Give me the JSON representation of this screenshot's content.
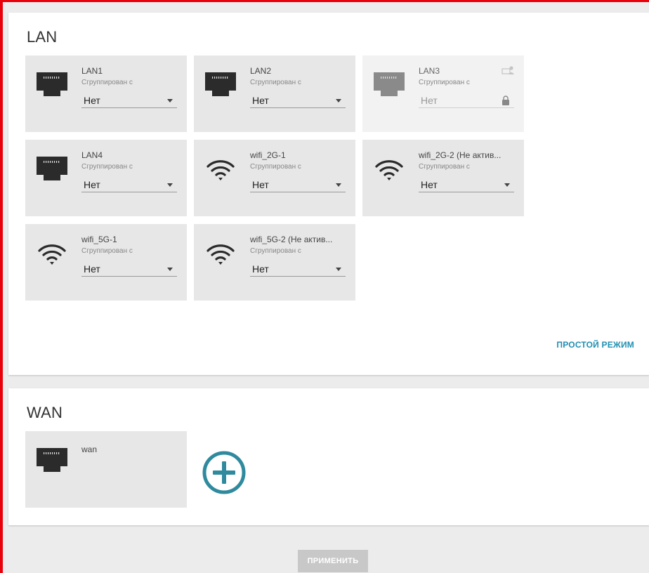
{
  "lan": {
    "title": "LAN",
    "ports": [
      {
        "name": "LAN1",
        "sub": "Сгруппирован с",
        "value": "Нет",
        "type": "ethernet",
        "state": "active"
      },
      {
        "name": "LAN2",
        "sub": "Сгруппирован с",
        "value": "Нет",
        "type": "ethernet",
        "state": "active"
      },
      {
        "name": "LAN3",
        "sub": "Сгруппирован с",
        "value": "Нет",
        "type": "ethernet",
        "state": "locked"
      },
      {
        "name": "LAN4",
        "sub": "Сгруппирован с",
        "value": "Нет",
        "type": "ethernet",
        "state": "active"
      },
      {
        "name": "wifi_2G-1",
        "sub": "Сгруппирован с",
        "value": "Нет",
        "type": "wifi",
        "state": "active"
      },
      {
        "name": "wifi_2G-2 (Не актив...",
        "sub": "Сгруппирован с",
        "value": "Нет",
        "type": "wifi",
        "state": "active"
      },
      {
        "name": "wifi_5G-1",
        "sub": "Сгруппирован с",
        "value": "Нет",
        "type": "wifi",
        "state": "active"
      },
      {
        "name": "wifi_5G-2 (Не актив...",
        "sub": "Сгруппирован с",
        "value": "Нет",
        "type": "wifi",
        "state": "active"
      }
    ],
    "mode_link": "ПРОСТОЙ РЕЖИМ"
  },
  "wan": {
    "title": "WAN",
    "ports": [
      {
        "name": "wan",
        "type": "ethernet"
      }
    ]
  },
  "apply_label": "ПРИМЕНИТЬ",
  "colors": {
    "accent": "#1f8fb1",
    "add_button": "#2f8a9e",
    "frame": "#e8000b",
    "card_bg": "#e7e7e7"
  }
}
